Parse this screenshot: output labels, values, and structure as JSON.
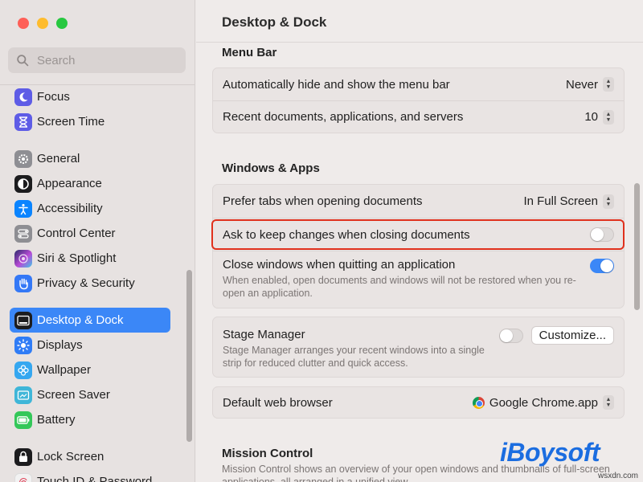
{
  "sidebar": {
    "search_placeholder": "Search",
    "items": [
      {
        "label": "Focus",
        "icon": "moon-icon",
        "color": "#5e5ce6"
      },
      {
        "label": "Screen Time",
        "icon": "hourglass-icon",
        "color": "#5e5ce6"
      },
      {
        "label": "General",
        "icon": "gear-icon",
        "color": "#8e8e93"
      },
      {
        "label": "Appearance",
        "icon": "appearance-icon",
        "color": "#1c1c1e"
      },
      {
        "label": "Accessibility",
        "icon": "accessibility-icon",
        "color": "#0a84ff"
      },
      {
        "label": "Control Center",
        "icon": "control-center-icon",
        "color": "#8e8e93"
      },
      {
        "label": "Siri & Spotlight",
        "icon": "siri-icon",
        "color": "#b84bd6"
      },
      {
        "label": "Privacy & Security",
        "icon": "hand-icon",
        "color": "#3478f6"
      },
      {
        "label": "Desktop & Dock",
        "icon": "dock-icon",
        "color": "#1c1c1e"
      },
      {
        "label": "Displays",
        "icon": "sun-icon",
        "color": "#2f7cf6"
      },
      {
        "label": "Wallpaper",
        "icon": "flower-icon",
        "color": "#35a7f0"
      },
      {
        "label": "Screen Saver",
        "icon": "screen-saver-icon",
        "color": "#3fb6d8"
      },
      {
        "label": "Battery",
        "icon": "battery-icon",
        "color": "#34c759"
      },
      {
        "label": "Lock Screen",
        "icon": "lock-icon",
        "color": "#1c1c1e"
      },
      {
        "label": "Touch ID & Password",
        "icon": "fingerprint-icon",
        "color": "#f2f2f2"
      }
    ]
  },
  "main": {
    "title": "Desktop & Dock",
    "menu_bar": {
      "title": "Menu Bar",
      "autohide_label": "Automatically hide and show the menu bar",
      "autohide_value": "Never",
      "recent_label": "Recent documents, applications, and servers",
      "recent_value": "10"
    },
    "windows_apps": {
      "title": "Windows & Apps",
      "prefer_tabs_label": "Prefer tabs when opening documents",
      "prefer_tabs_value": "In Full Screen",
      "ask_keep_label": "Ask to keep changes when closing documents",
      "close_windows_label": "Close windows when quitting an application",
      "close_windows_desc": "When enabled, open documents and windows will not be restored when you re-open an application.",
      "stage_manager_label": "Stage Manager",
      "stage_manager_desc": "Stage Manager arranges your recent windows into a single strip for reduced clutter and quick access.",
      "customize_label": "Customize...",
      "browser_label": "Default web browser",
      "browser_value": "Google Chrome.app"
    },
    "mission_control": {
      "title": "Mission Control",
      "desc": "Mission Control shows an overview of your open windows and thumbnails of full-screen applications, all arranged in a unified view."
    }
  },
  "toggles": {
    "ask_keep_changes": false,
    "close_windows": true,
    "stage_manager": false
  },
  "watermark": {
    "brand": "iBoysoft",
    "site": "wsxdn.com"
  }
}
